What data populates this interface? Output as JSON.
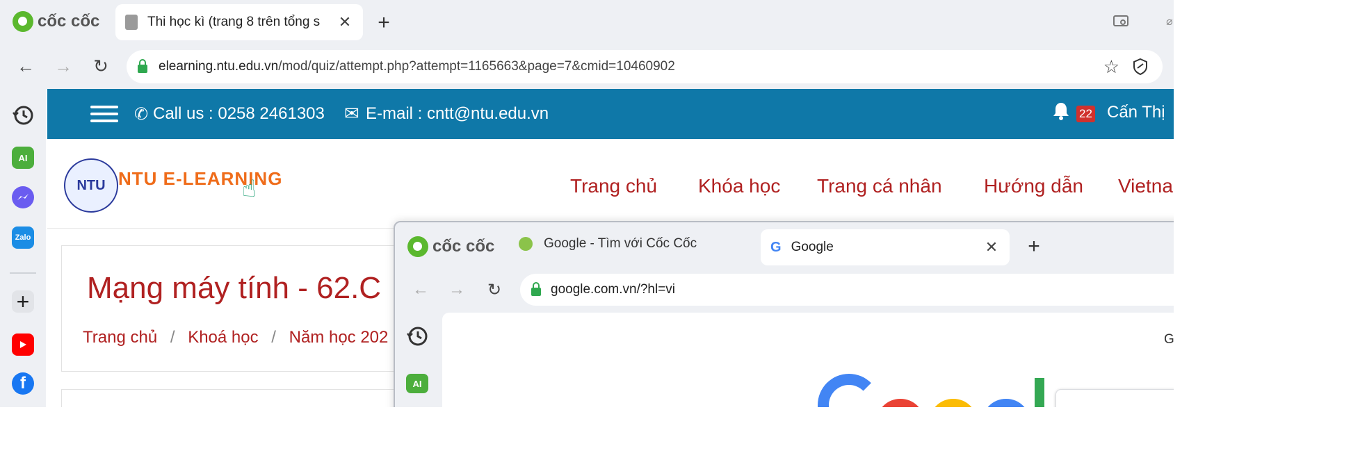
{
  "browser": {
    "brand": "cốc cốc",
    "active_tab_title": "Thi học kì (trang 8 trên tổng s",
    "url_domain": "elearning.ntu.edu.vn",
    "url_path": "/mod/quiz/attempt.php?attempt=1165663&page=7&cmid=10460902"
  },
  "sidebar": {
    "items": [
      "history",
      "ai",
      "messenger",
      "zalo",
      "add",
      "youtube",
      "facebook"
    ],
    "ai_label": "AI",
    "zalo_label": "Zalo"
  },
  "site": {
    "call_text": "Call us : 0258 2461303",
    "email_text": "E-mail : cntt@ntu.edu.vn",
    "notif_count": "22",
    "user_name": "Cấn Thị",
    "logo_text": "NTU E-LEARNING",
    "logo_badge": "NTU",
    "nav": [
      "Trang chủ",
      "Khóa học",
      "Trang cá nhân",
      "Hướng dẫn",
      "Vietna"
    ],
    "course_title": "Mạng máy tính - 62.C",
    "breadcrumb": [
      "Trang chủ",
      "Khoá học",
      "Năm học 202"
    ]
  },
  "inner_browser": {
    "brand": "cốc cốc",
    "tab1_title": "Google - Tìm với Cốc Cốc",
    "tab2_title": "Google",
    "url": "google.com.vn/?hl=vi",
    "ai_label": "AI",
    "page_partial_text": "G"
  },
  "colors": {
    "topbar": "#0f78a8",
    "nav_link": "#b02121",
    "logo_orange": "#ef6c1a"
  }
}
